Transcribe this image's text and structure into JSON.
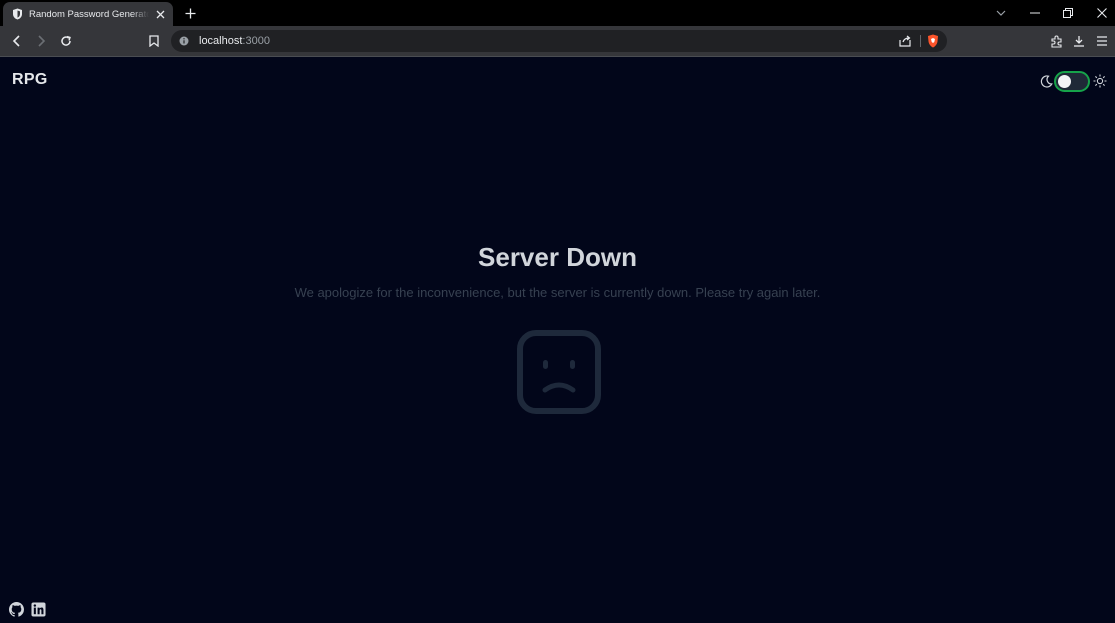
{
  "browser": {
    "tab": {
      "title": "Random Password Generator Tool",
      "favicon": "shield-icon"
    },
    "address": {
      "host": "localhost",
      "port": ":3000"
    },
    "icons": [
      "back-icon",
      "forward-icon",
      "reload-icon",
      "bookmark-icon",
      "info-icon",
      "share-icon",
      "brave-shield-icon",
      "extensions-icon",
      "download-icon",
      "menu-icon",
      "minimize-icon",
      "restore-icon",
      "close-icon",
      "chevron-down-icon",
      "new-tab-icon"
    ]
  },
  "app": {
    "brand": "RPG",
    "theme_toggle": {
      "state": "dark",
      "accent": "#16a34a"
    }
  },
  "error": {
    "title": "Server Down",
    "message": "We apologize for the inconvenience, but the server is currently down. Please try again later.",
    "icon": "sad-face-icon"
  },
  "footer": {
    "links": [
      "github-icon",
      "linkedin-icon"
    ]
  },
  "colors": {
    "background": "#02061a",
    "title": "#d1d5db",
    "message": "#374151",
    "icon": "#1e293b"
  }
}
